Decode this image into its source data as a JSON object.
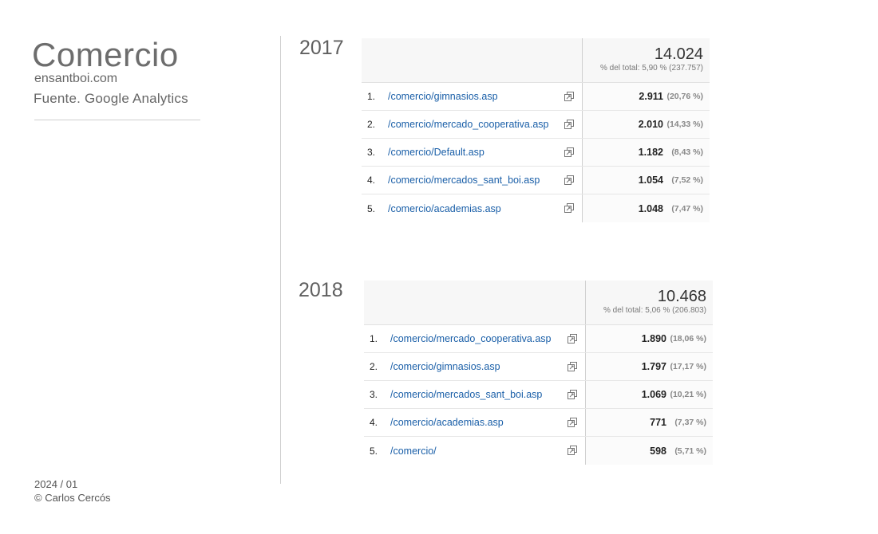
{
  "sidebar": {
    "title": "Comercio",
    "site": "ensantboi.com",
    "source": "Fuente. Google Analytics",
    "date": "2024 / 01",
    "author": "© Carlos Cercós"
  },
  "reports": [
    {
      "year": "2017",
      "total": "14.024",
      "total_pct": "% del total: 5,90 % (237.757)",
      "rows": [
        {
          "idx": "1.",
          "page": "/comercio/gimnasios.asp",
          "value": "2.911",
          "share": "(20,76 %)"
        },
        {
          "idx": "2.",
          "page": "/comercio/mercado_cooperativa.asp",
          "value": "2.010",
          "share": "(14,33 %)"
        },
        {
          "idx": "3.",
          "page": "/comercio/Default.asp",
          "value": "1.182",
          "share": "(8,43 %)"
        },
        {
          "idx": "4.",
          "page": "/comercio/mercados_sant_boi.asp",
          "value": "1.054",
          "share": "(7,52 %)"
        },
        {
          "idx": "5.",
          "page": "/comercio/academias.asp",
          "value": "1.048",
          "share": "(7,47 %)"
        }
      ]
    },
    {
      "year": "2018",
      "total": "10.468",
      "total_pct": "% del total: 5,06 % (206.803)",
      "rows": [
        {
          "idx": "1.",
          "page": "/comercio/mercado_cooperativa.asp",
          "value": "1.890",
          "share": "(18,06 %)"
        },
        {
          "idx": "2.",
          "page": "/comercio/gimnasios.asp",
          "value": "1.797",
          "share": "(17,17 %)"
        },
        {
          "idx": "3.",
          "page": "/comercio/mercados_sant_boi.asp",
          "value": "1.069",
          "share": "(10,21 %)"
        },
        {
          "idx": "4.",
          "page": "/comercio/academias.asp",
          "value": "771",
          "share": "(7,37 %)"
        },
        {
          "idx": "5.",
          "page": "/comercio/",
          "value": "598",
          "share": "(5,71 %)"
        }
      ]
    }
  ],
  "icons": {
    "row_action": "external-window-icon"
  }
}
